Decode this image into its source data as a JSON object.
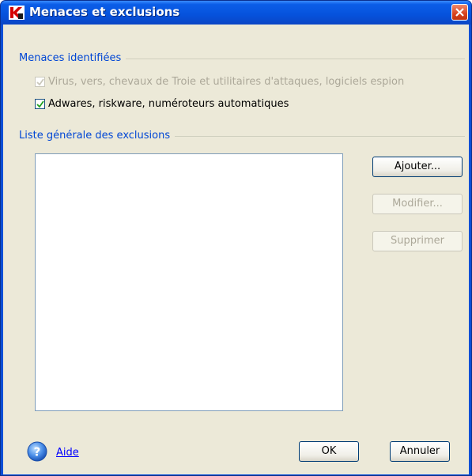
{
  "window": {
    "title": "Menaces et exclusions",
    "icon": "kaspersky-k-icon",
    "colors": {
      "titlebar": "#0652dc",
      "client_bg": "#ece9d8",
      "group_label": "#0046d5",
      "close": "#d8431f"
    }
  },
  "threats_group": {
    "label": "Menaces identifiées",
    "items": [
      {
        "label": "Virus, vers, chevaux de Troie et utilitaires d'attaques, logiciels espion",
        "checked": true,
        "disabled": true
      },
      {
        "label": "Adwares, riskware, numéroteurs automatiques",
        "checked": true,
        "disabled": false
      }
    ]
  },
  "exclusions_group": {
    "label": "Liste générale des exclusions",
    "list_items": [],
    "buttons": {
      "add": "Ajouter...",
      "edit": "Modifier...",
      "delete": "Supprimer"
    }
  },
  "footer": {
    "help_label": "Aide",
    "ok_label": "OK",
    "cancel_label": "Annuler"
  }
}
